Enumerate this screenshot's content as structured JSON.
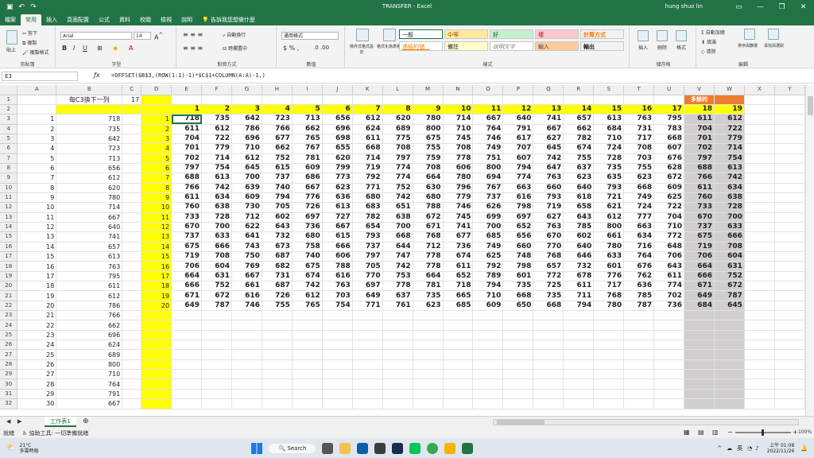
{
  "title": "TRANSFER - Excel",
  "user": "hung shuo lin",
  "tabs": [
    "檔案",
    "常用",
    "插入",
    "頁面配置",
    "公式",
    "資料",
    "校閱",
    "檢視",
    "說明",
    "告訴我您想做什麼"
  ],
  "ribbon": {
    "paste": "貼上",
    "cut": "剪下",
    "copy": "複製",
    "format_painter": "複製格式",
    "clipboard": "剪貼簿",
    "font_name": "Arial",
    "font_size": "14",
    "font_group": "字型",
    "wrap_text": "自動換行",
    "merge_center": "跨欄置中",
    "alignment": "對齊方式",
    "number_format": "通用格式",
    "number": "數值",
    "cond_format": "條件式格式設定",
    "format_as_table": "格式化為表格",
    "styles_label": "樣式",
    "styles": [
      "一般",
      "中等",
      "好",
      "壞",
      "計算方式",
      "連結的儲...",
      "備註",
      "說明文字",
      "輸入",
      "輸出"
    ],
    "insert": "插入",
    "delete": "刪除",
    "format": "格式",
    "cells": "儲存格",
    "autosum": "自動加總",
    "fill": "填滿",
    "clear": "清除",
    "sort_filter": "排序與篩選",
    "find_select": "尋找與選取",
    "editing": "編輯"
  },
  "name_box": "E3",
  "formula": "=OFFSET($B$3,(ROW(1:1)-1)*$C$1+COLUMN(A:A)-1,)",
  "columns": [
    "A",
    "B",
    "C",
    "D",
    "E",
    "F",
    "G",
    "H",
    "I",
    "J",
    "K",
    "L",
    "M",
    "N",
    "O",
    "P",
    "Q",
    "R",
    "S",
    "T",
    "U",
    "V",
    "W",
    "X",
    "Y"
  ],
  "cells": {
    "B1": "每C3換下一列",
    "C1": "17",
    "V1": "多餘的"
  },
  "row2": [
    1,
    2,
    3,
    4,
    5,
    6,
    7,
    8,
    9,
    10,
    11,
    12,
    13,
    14,
    15,
    16,
    17,
    18,
    19
  ],
  "colA": [
    1,
    2,
    3,
    4,
    5,
    6,
    7,
    8,
    9,
    10,
    11,
    12,
    13,
    14,
    15,
    16,
    17,
    18,
    19,
    20,
    21,
    22,
    23,
    24,
    25,
    26,
    27,
    28,
    29,
    30
  ],
  "colB": [
    718,
    735,
    642,
    723,
    713,
    656,
    612,
    620,
    780,
    714,
    667,
    640,
    741,
    657,
    613,
    763,
    795,
    611,
    612,
    786,
    766,
    662,
    696,
    624,
    689,
    800,
    710,
    764,
    791,
    667
  ],
  "grid": [
    [
      718,
      735,
      642,
      723,
      713,
      656,
      612,
      620,
      780,
      714,
      667,
      640,
      741,
      657,
      613,
      763,
      795,
      611,
      612
    ],
    [
      611,
      612,
      786,
      766,
      662,
      696,
      624,
      689,
      800,
      710,
      764,
      791,
      667,
      662,
      684,
      731,
      783,
      704,
      722
    ],
    [
      704,
      722,
      696,
      677,
      765,
      698,
      611,
      775,
      675,
      745,
      746,
      617,
      627,
      782,
      710,
      717,
      668,
      701,
      779
    ],
    [
      701,
      779,
      710,
      662,
      767,
      655,
      668,
      708,
      755,
      708,
      749,
      707,
      645,
      674,
      724,
      708,
      607,
      702,
      714
    ],
    [
      702,
      714,
      612,
      752,
      781,
      620,
      714,
      797,
      759,
      778,
      751,
      607,
      742,
      755,
      728,
      703,
      676,
      797,
      754
    ],
    [
      797,
      754,
      645,
      615,
      609,
      799,
      719,
      774,
      708,
      606,
      800,
      794,
      647,
      637,
      735,
      755,
      628,
      688,
      613
    ],
    [
      688,
      613,
      700,
      737,
      686,
      773,
      792,
      774,
      664,
      780,
      694,
      774,
      763,
      623,
      635,
      623,
      672,
      766,
      742
    ],
    [
      766,
      742,
      639,
      740,
      667,
      623,
      771,
      752,
      630,
      796,
      767,
      663,
      660,
      640,
      793,
      668,
      609,
      611,
      634
    ],
    [
      611,
      634,
      609,
      794,
      776,
      636,
      680,
      742,
      680,
      779,
      737,
      616,
      793,
      618,
      721,
      749,
      625,
      760,
      638
    ],
    [
      760,
      638,
      730,
      705,
      726,
      613,
      683,
      651,
      788,
      746,
      626,
      798,
      719,
      658,
      621,
      724,
      722,
      733,
      728
    ],
    [
      733,
      728,
      712,
      602,
      697,
      727,
      782,
      638,
      672,
      745,
      699,
      697,
      627,
      643,
      612,
      777,
      704,
      670,
      700
    ],
    [
      670,
      700,
      622,
      643,
      736,
      667,
      654,
      700,
      671,
      741,
      700,
      652,
      763,
      785,
      800,
      663,
      710,
      737,
      633
    ],
    [
      737,
      633,
      641,
      732,
      680,
      615,
      793,
      668,
      768,
      677,
      685,
      656,
      670,
      602,
      661,
      634,
      772,
      675,
      666
    ],
    [
      675,
      666,
      743,
      673,
      758,
      666,
      737,
      644,
      712,
      736,
      749,
      660,
      770,
      640,
      780,
      716,
      648,
      719,
      708
    ],
    [
      719,
      708,
      750,
      687,
      740,
      606,
      797,
      747,
      778,
      674,
      625,
      748,
      768,
      646,
      633,
      764,
      706,
      706,
      604
    ],
    [
      706,
      604,
      769,
      682,
      675,
      788,
      705,
      742,
      778,
      611,
      792,
      798,
      657,
      732,
      601,
      676,
      643,
      664,
      631
    ],
    [
      664,
      631,
      667,
      731,
      674,
      616,
      770,
      753,
      664,
      652,
      789,
      601,
      772,
      678,
      776,
      762,
      611,
      666,
      752
    ],
    [
      666,
      752,
      661,
      687,
      742,
      763,
      697,
      778,
      781,
      718,
      794,
      735,
      725,
      611,
      717,
      636,
      774,
      671,
      672
    ],
    [
      671,
      672,
      616,
      726,
      612,
      703,
      649,
      637,
      735,
      665,
      710,
      668,
      735,
      711,
      768,
      785,
      702,
      649,
      787
    ],
    [
      649,
      787,
      746,
      755,
      765,
      754,
      771,
      761,
      623,
      685,
      609,
      650,
      668,
      794,
      780,
      787,
      736,
      684,
      645
    ]
  ],
  "sheet_tab": "工作表1",
  "status": {
    "ready": "就緒",
    "accessibility": "協助工具: 一切準備就緒",
    "zoom": "100%"
  },
  "taskbar": {
    "weather_temp": "21°C",
    "weather_desc": "多雲時陰",
    "search": "Search",
    "lang": "英",
    "time": "上午 01:08",
    "date": "2022/11/26"
  },
  "colors": {
    "excel_green": "#217346",
    "yellow": "#ffff00",
    "gray": "#d0cece",
    "orange": "#ed7d31"
  }
}
